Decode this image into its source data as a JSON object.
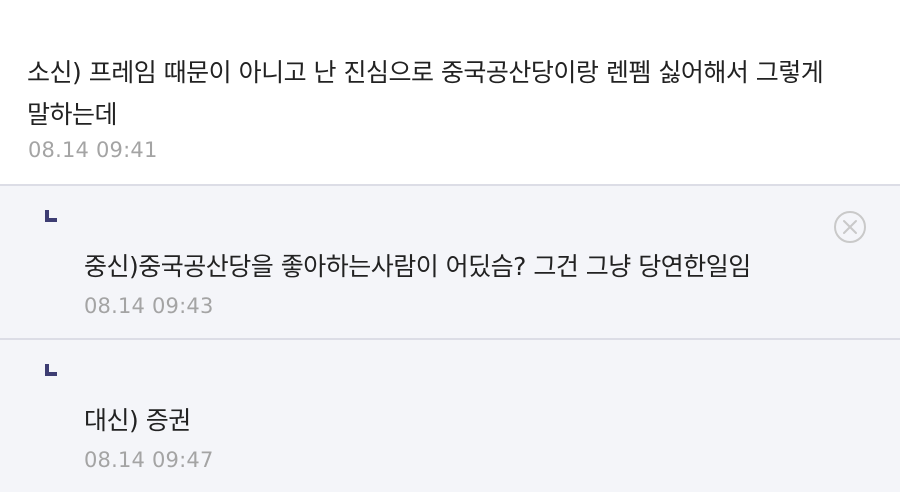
{
  "comment": {
    "text": "소신) 프레임 때문이 아니고 난 진심으로 중국공산당이랑 렌펨 싫어해서 그렇게 말하는데",
    "time": "08.14 09:41"
  },
  "replies": [
    {
      "text": "중신)중국공산당을 좋아하는사람이 어딨슴? 그건 그냥 당연한일임",
      "time": "08.14 09:43",
      "icons": [
        "reply-arrow-icon",
        "close-circle-icon"
      ]
    },
    {
      "text": "대신) 증권",
      "time": "08.14 09:47",
      "icons": [
        "reply-arrow-icon"
      ]
    }
  ],
  "colors": {
    "text": "#222222",
    "timestamp": "#a4a4a4",
    "reply_background": "#f4f5f9",
    "divider": "#dcdde6",
    "reply_arrow": "#3d3d73",
    "delete_icon": "#c9c9c9"
  }
}
